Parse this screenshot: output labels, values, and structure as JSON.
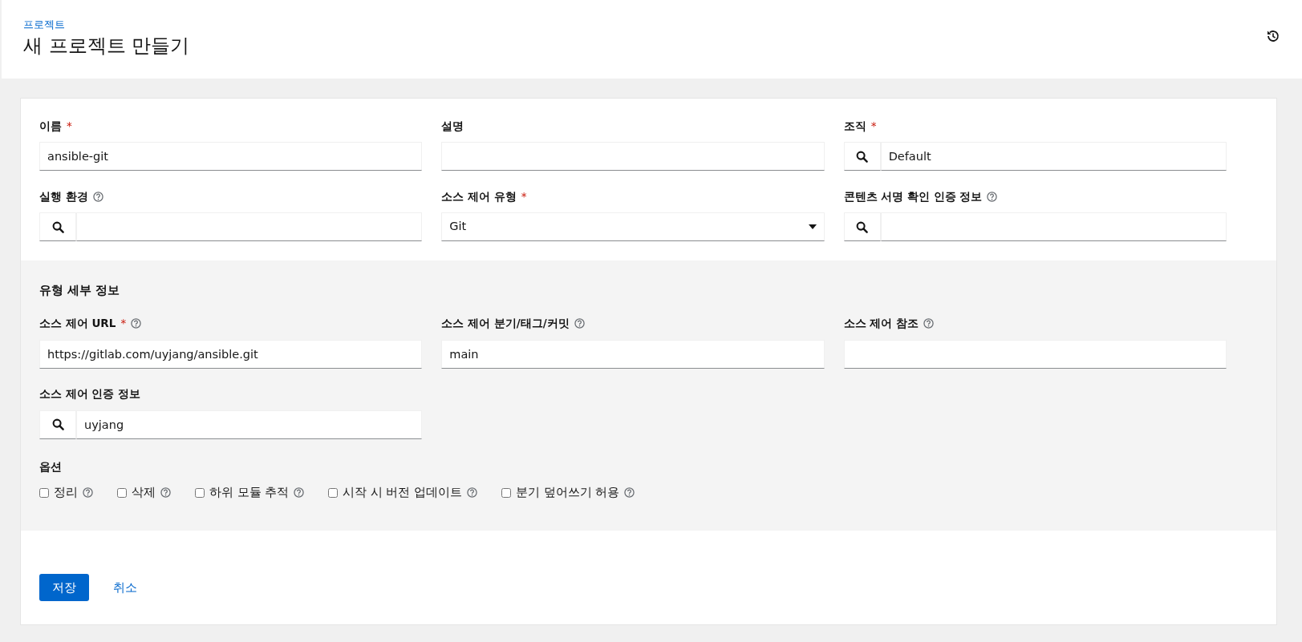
{
  "breadcrumb": "프로젝트",
  "title": "새 프로젝트 만들기",
  "fields": [
    {
      "label": "이름",
      "required_mark": "*",
      "help": false,
      "kind": "text",
      "value": "ansible-git"
    },
    {
      "label": "설명",
      "help": false,
      "kind": "text"
    },
    {
      "label": "조직",
      "required_mark": "*",
      "help": false,
      "kind": "lookup",
      "value": "Default"
    },
    {
      "label": "실행 환경",
      "help": true,
      "kind": "lookup"
    },
    {
      "label": "소스 제어 유형",
      "required_mark": "*",
      "help": false,
      "kind": "select",
      "value": "Git"
    },
    {
      "label": "콘텐츠 서명 확인 인증 정보",
      "help": true,
      "kind": "lookup"
    }
  ],
  "type_details": {
    "heading": "유형 세부 정보",
    "fields": [
      {
        "label": "소스 제어 URL",
        "required_mark": "*",
        "help": true,
        "kind": "text",
        "value": "https://gitlab.com/uyjang/ansible.git"
      },
      {
        "label": "소스 제어 분기/태그/커밋",
        "help": true,
        "kind": "text",
        "value": "main"
      },
      {
        "label": "소스 제어 참조",
        "help": true,
        "kind": "text"
      },
      {
        "label": "소스 제어 인증 정보",
        "help": false,
        "kind": "lookup",
        "value": "uyjang"
      }
    ],
    "options_heading": "옵션",
    "options": [
      {
        "label": "정리",
        "checked": false,
        "help": true
      },
      {
        "label": "삭제",
        "checked": false,
        "help": true
      },
      {
        "label": "하위 모듈 추적",
        "checked": false,
        "help": true
      },
      {
        "label": "시작 시 버전 업데이트",
        "checked": false,
        "help": true
      },
      {
        "label": "분기 덮어쓰기 허용",
        "checked": false,
        "help": true
      }
    ]
  },
  "buttons": [
    {
      "label": "저장",
      "kind": "primary"
    },
    {
      "label": "취소",
      "kind": "link"
    }
  ]
}
